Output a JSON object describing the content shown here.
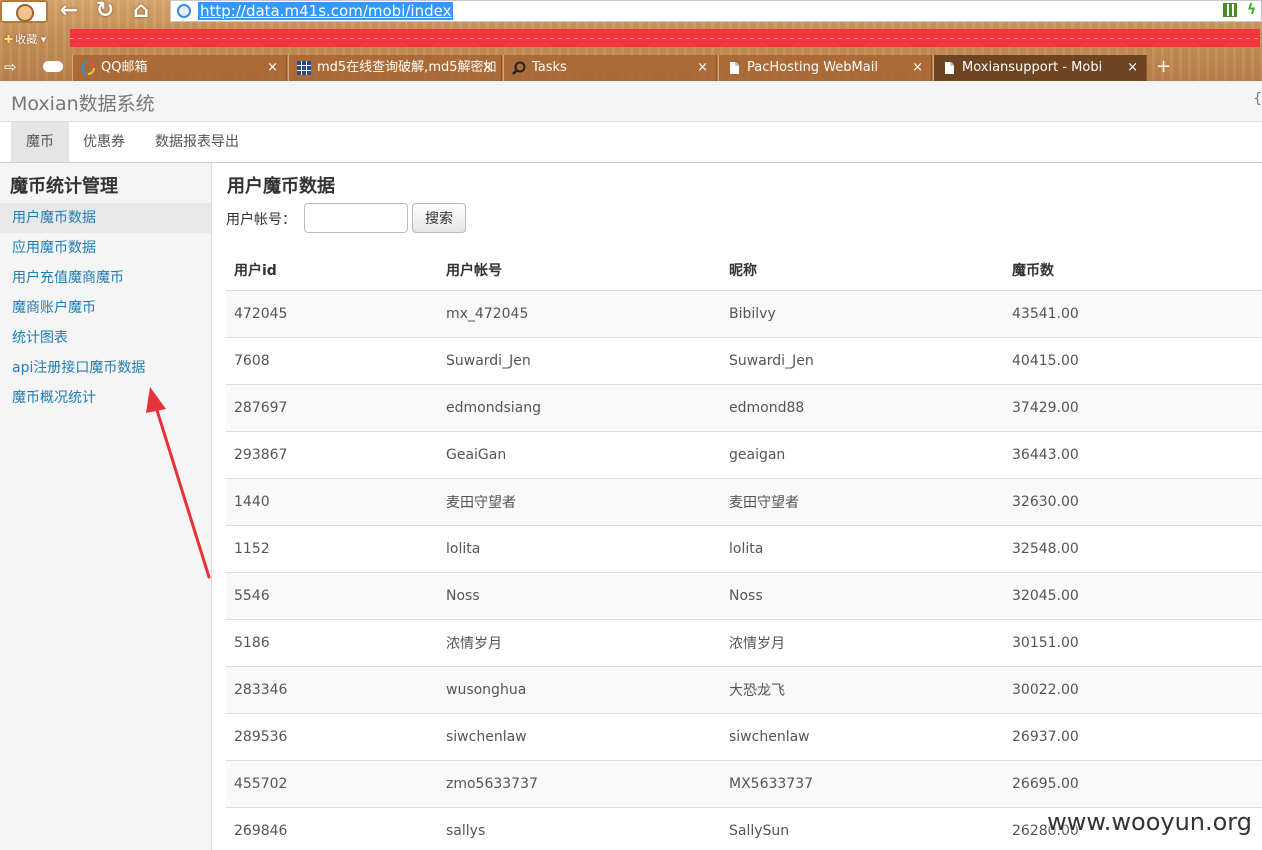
{
  "browser": {
    "url": "http://data.m41s.com/mobi/index",
    "favorites_label": "收藏",
    "tabs": [
      {
        "label": "QQ邮箱",
        "icon": "qq-mail-icon"
      },
      {
        "label": "md5在线查询破解,md5解密加",
        "icon": "grid-icon"
      },
      {
        "label": "Tasks",
        "icon": "search-icon"
      },
      {
        "label": "PacHosting WebMail",
        "icon": "page-icon"
      },
      {
        "label": "Moxiansupport - Mobi",
        "icon": "page-icon"
      }
    ],
    "new_tab": "+",
    "close_glyph": "×"
  },
  "app": {
    "title": "Moxian数据系统",
    "header_right": "{"
  },
  "nav": {
    "tabs": [
      "魔币",
      "优惠券",
      "数据报表导出"
    ],
    "active": 0
  },
  "sidebar": {
    "title": "魔币统计管理",
    "items": [
      "用户魔币数据",
      "应用魔币数据",
      "用户充值魔商魔币",
      "魔商账户魔币",
      "统计图表",
      "api注册接口魔币数据",
      "魔币概况统计"
    ],
    "active": 0
  },
  "main": {
    "title": "用户魔币数据",
    "search_label": "用户帐号：",
    "search_button": "搜索",
    "search_value": "",
    "columns": [
      "用户id",
      "用户帐号",
      "昵称",
      "魔币数"
    ],
    "rows": [
      [
        "472045",
        "mx_472045",
        "Bibilvy",
        "43541.00"
      ],
      [
        "7608",
        "Suwardi_Jen",
        "Suwardi_Jen",
        "40415.00"
      ],
      [
        "287697",
        "edmondsiang",
        "edmond88",
        "37429.00"
      ],
      [
        "293867",
        "GeaiGan",
        "geaigan",
        "36443.00"
      ],
      [
        "1440",
        "麦田守望者",
        "麦田守望者",
        "32630.00"
      ],
      [
        "1152",
        "lolita",
        "lolita",
        "32548.00"
      ],
      [
        "5546",
        "Noss",
        "Noss",
        "32045.00"
      ],
      [
        "5186",
        "浓情岁月",
        "浓情岁月",
        "30151.00"
      ],
      [
        "283346",
        "wusonghua",
        "大恐龙飞",
        "30022.00"
      ],
      [
        "289536",
        "siwchenlaw",
        "siwchenlaw",
        "26937.00"
      ],
      [
        "455702",
        "zmo5633737",
        "MX5633737",
        "26695.00"
      ],
      [
        "269846",
        "sallys",
        "SallySun",
        "26280.00"
      ]
    ]
  },
  "watermark": "www.wooyun.org",
  "colors": {
    "link": "#1f7db5",
    "annotation": "#e8323a",
    "selection": "#3399ff"
  }
}
